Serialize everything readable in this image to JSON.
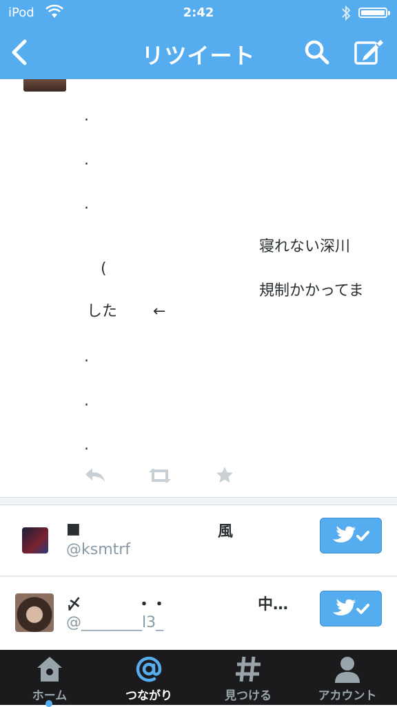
{
  "status_bar": {
    "carrier": "iPod",
    "time": "2:42"
  },
  "nav": {
    "title": "リツイート"
  },
  "tweet": {
    "dot1": ".",
    "dot2": ".",
    "dot3": ".",
    "line_right_1": "寝れない深川",
    "paren": "(",
    "line_right_2": "規制かかってま",
    "line_left": "した",
    "arrow": "←",
    "dot4": ".",
    "dot5": ".",
    "dot6": "."
  },
  "users": [
    {
      "name": "■",
      "name_right": "風",
      "handle": "@ksmtrf"
    },
    {
      "name": "〆",
      "name_mid": "・・",
      "name_right": "中…",
      "handle": "@________l3_"
    }
  ],
  "tabbar": {
    "tabs": [
      {
        "label": "ホーム",
        "icon": "home-icon"
      },
      {
        "label": "つながり",
        "icon": "at-icon"
      },
      {
        "label": "見つける",
        "icon": "hashtag-icon"
      },
      {
        "label": "アカウント",
        "icon": "account-icon"
      }
    ]
  },
  "colors": {
    "accent": "#55acee",
    "tabbar": "#1b1b1d"
  }
}
